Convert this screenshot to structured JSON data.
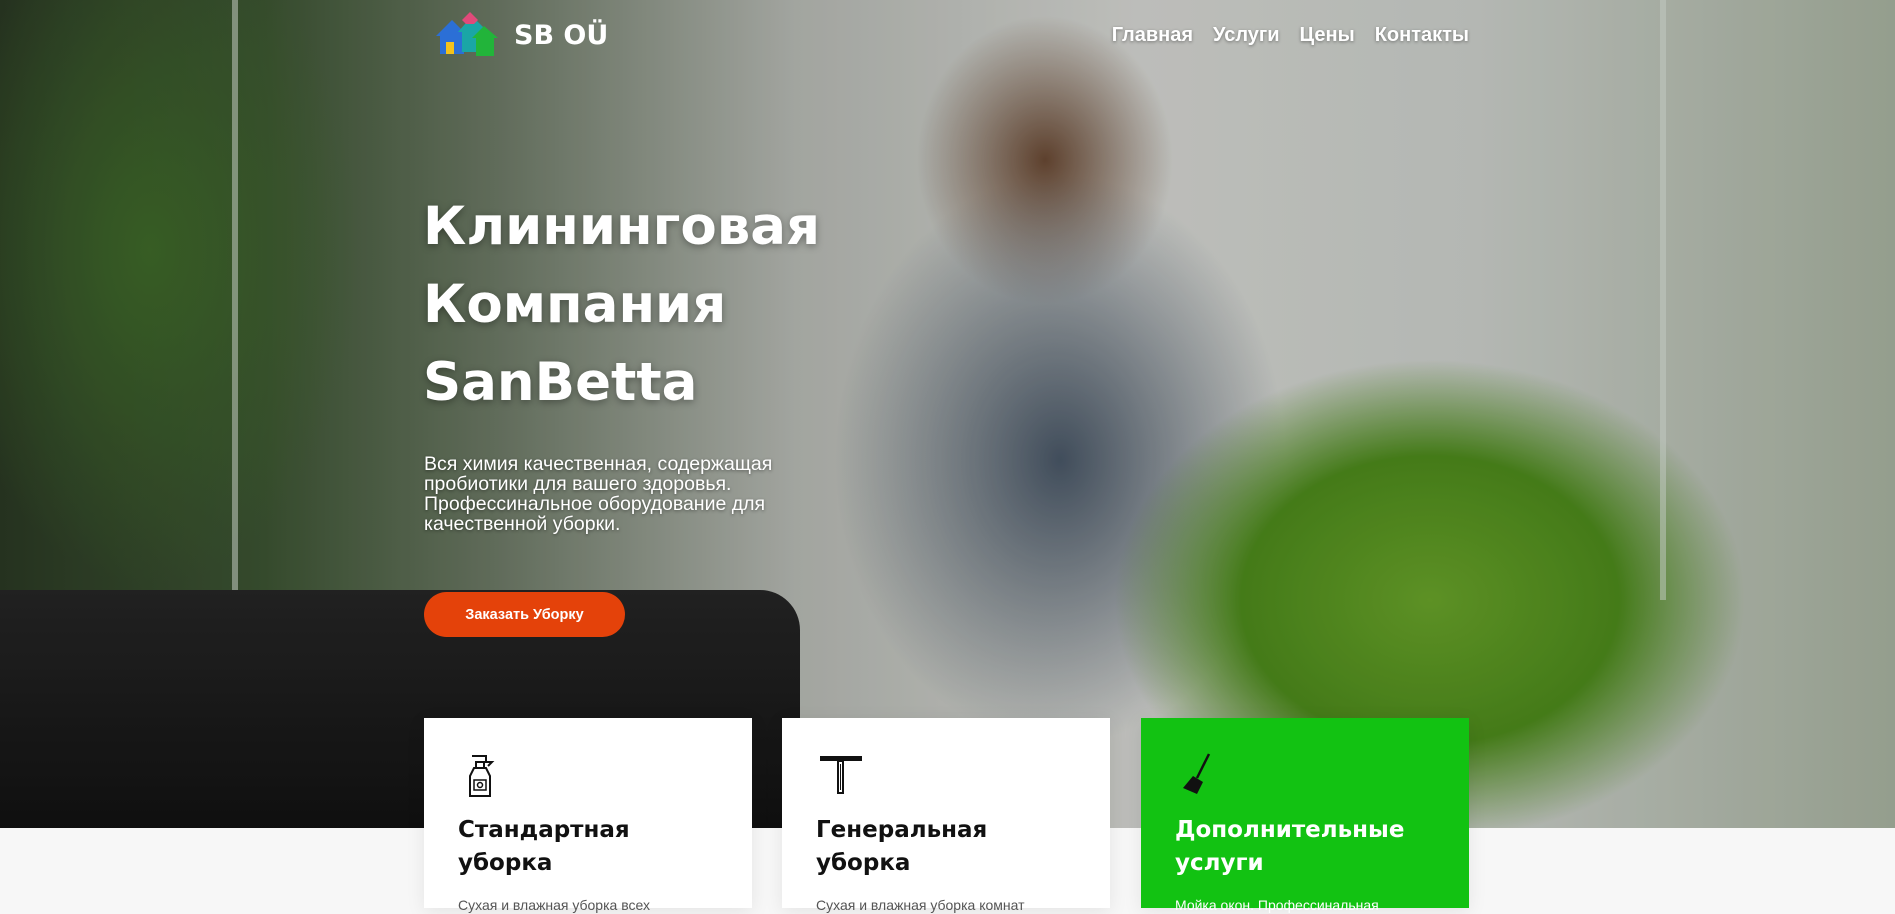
{
  "brand": {
    "name": "SB OÜ"
  },
  "nav": {
    "items": [
      "Главная",
      "Услуги",
      "Цены",
      "Контакты"
    ]
  },
  "hero": {
    "title_lines": [
      "Клининговая",
      "Компания",
      "SanBetta"
    ],
    "subtitle": "Вся химия качественная, содержащая пробиотики для вашего здоровья. Профессинальное оборудование для качественной уборки.",
    "cta_label": "Заказать Уборку"
  },
  "cards": [
    {
      "icon": "spray-bottle-icon",
      "title_lines": [
        "Стандартная",
        "уборка"
      ],
      "text": "Сухая и влажная уборка всех"
    },
    {
      "icon": "squeegee-icon",
      "title_lines": [
        "Генеральная",
        "уборка"
      ],
      "text": "Сухая и влажная уборка комнат"
    },
    {
      "icon": "broom-icon",
      "title_lines": [
        "Дополнительные",
        "услуги"
      ],
      "text": "Мойка окон. Профессинальная"
    }
  ],
  "colors": {
    "accent_orange": "#e4420a",
    "accent_green": "#12c212"
  }
}
